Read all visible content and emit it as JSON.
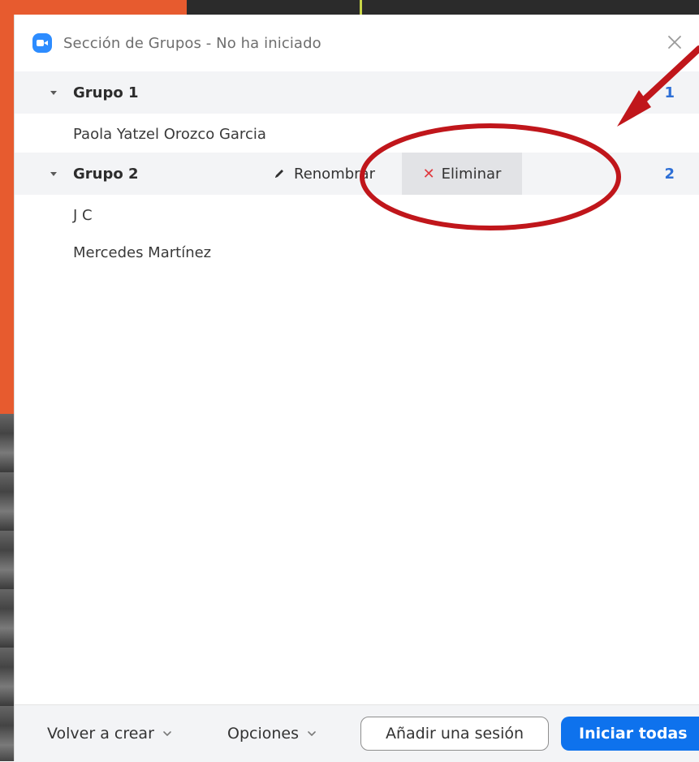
{
  "window": {
    "title": "Sección de Grupos - No ha iniciado"
  },
  "groups": [
    {
      "name": "Grupo 1",
      "count": "1",
      "participants": [
        "Paola Yatzel Orozco Garcia"
      ]
    },
    {
      "name": "Grupo 2",
      "count": "2",
      "participants": [
        "J C",
        "Mercedes Martínez"
      ],
      "actions": {
        "rename": "Renombrar",
        "delete": "Eliminar"
      }
    }
  ],
  "footer": {
    "recreate": "Volver a crear",
    "options": "Opciones",
    "add_session": "Añadir una sesión",
    "start_all": "Iniciar todas"
  },
  "colors": {
    "accent": "#0e72ed",
    "count": "#2d6fd6",
    "delete_x": "#e0393e",
    "annotation": "#c0161b"
  },
  "icons": {
    "app": "zoom-camera-icon",
    "close": "close-icon",
    "collapse": "triangle-down-icon",
    "rename": "pencil-icon",
    "delete": "x-icon",
    "dropdown": "chevron-down-icon"
  }
}
